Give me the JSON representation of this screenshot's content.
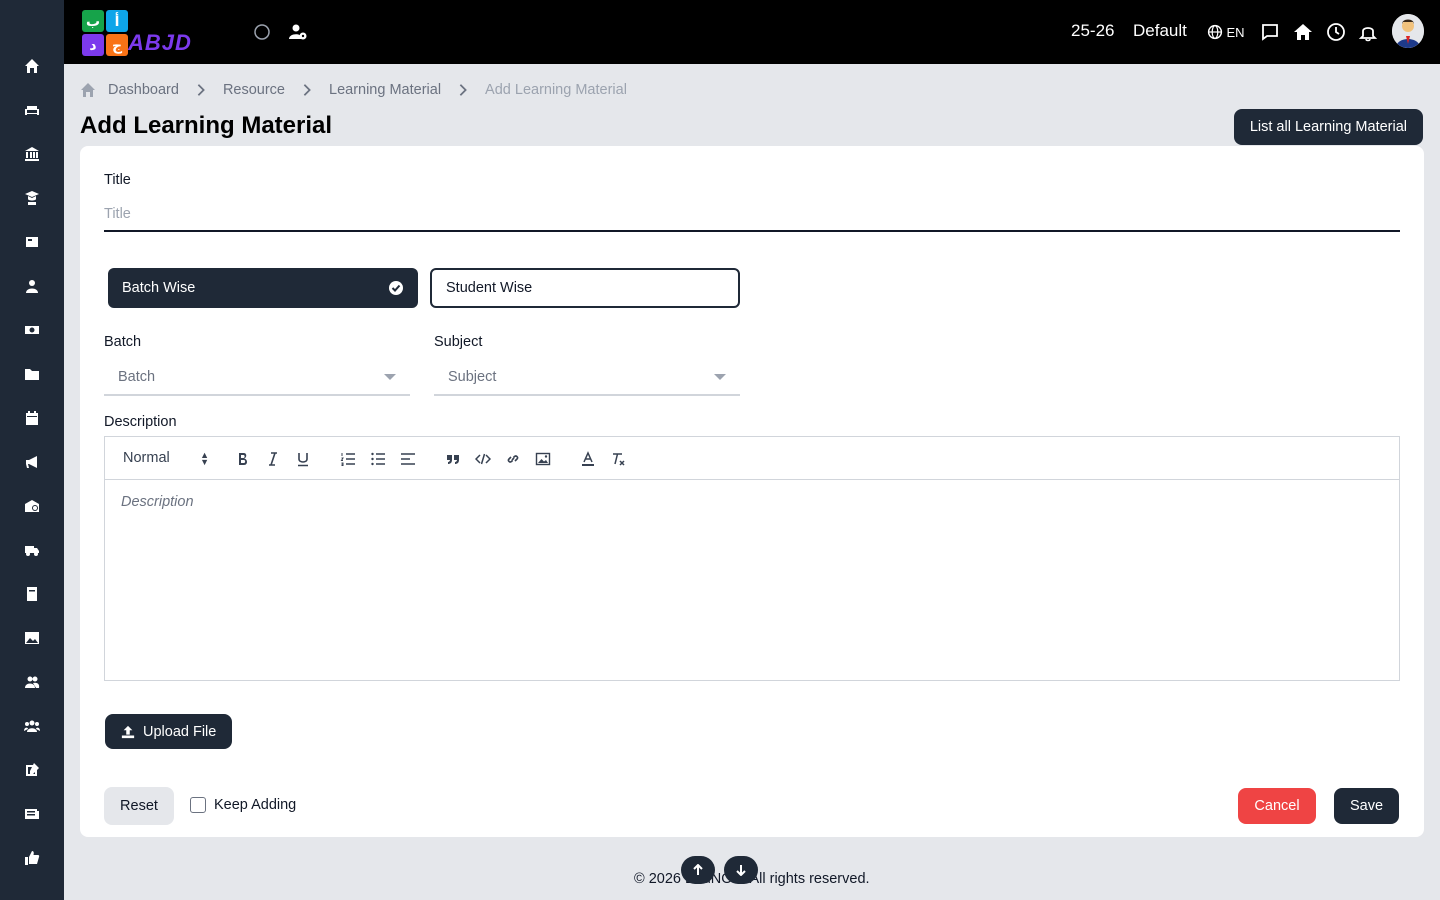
{
  "app": {
    "logo_text": "ABJD",
    "logo_letters": [
      "ب",
      "أ",
      "د",
      "ج"
    ],
    "session": "25-26",
    "profile": "Default",
    "language": "EN"
  },
  "sidebar": {
    "items": [
      "home-icon",
      "sofa-icon",
      "bank-icon",
      "graduate-icon",
      "newspaper-icon",
      "user-icon",
      "money-icon",
      "folder-icon",
      "calendar-icon",
      "megaphone-icon",
      "school-icon",
      "truck-icon",
      "book-icon",
      "image-icon",
      "users-icon",
      "group-icon",
      "edit-icon",
      "news-icon",
      "thumbs-up-icon"
    ]
  },
  "breadcrumb": {
    "items": [
      "Dashboard",
      "Resource",
      "Learning Material"
    ],
    "current": "Add Learning Material"
  },
  "page": {
    "title": "Add Learning Material",
    "list_button": "List all Learning Material"
  },
  "form": {
    "title_label": "Title",
    "title_placeholder": "Title",
    "title_value": "",
    "toggle_batch": "Batch Wise",
    "toggle_student": "Student Wise",
    "batch_label": "Batch",
    "batch_value": "Batch",
    "subject_label": "Subject",
    "subject_value": "Subject",
    "description_label": "Description",
    "heading_format": "Normal",
    "description_placeholder": "Description",
    "upload_button": "Upload File",
    "reset_button": "Reset",
    "keep_adding": "Keep Adding",
    "cancel_button": "Cancel",
    "save_button": "Save"
  },
  "footer": {
    "text": "© 2026 EduNOS. All rights reserved."
  },
  "colors": {
    "sidebar": "#1f2937",
    "topbar": "#000000",
    "primary": "#1f2937",
    "danger": "#ef4444",
    "background": "#e5e7eb"
  }
}
